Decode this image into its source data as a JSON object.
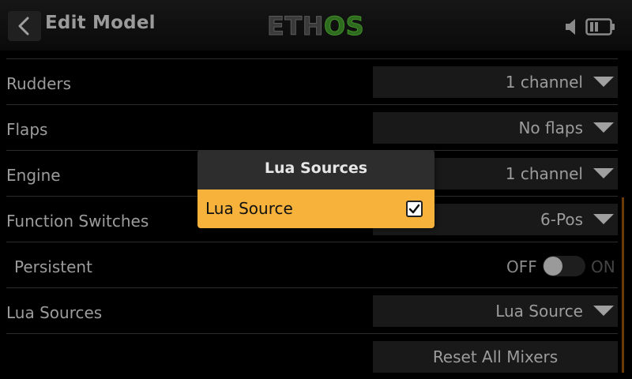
{
  "header": {
    "title": "Edit Model",
    "logo_part1": "ETH",
    "logo_part2": "OS",
    "back_icon": "chevron-left-icon",
    "speaker_icon": "speaker-muted-icon",
    "battery_icon": "battery-icon"
  },
  "rows": {
    "rudders": {
      "label": "Rudders",
      "value": "1 channel"
    },
    "flaps": {
      "label": "Flaps",
      "value": "No flaps"
    },
    "engine": {
      "label": "Engine",
      "value": "1 channel"
    },
    "function_switches": {
      "label": "Function Switches",
      "value": "6-Pos"
    },
    "persistent": {
      "label": "Persistent",
      "off_label": "OFF",
      "on_label": "ON",
      "state": "off"
    },
    "lua_sources": {
      "label": "Lua Sources",
      "value": "Lua Source"
    },
    "reset": {
      "button_label": "Reset All Mixers"
    }
  },
  "popup": {
    "title": "Lua Sources",
    "items": [
      {
        "label": "Lua Source",
        "checked": true
      }
    ]
  },
  "colors": {
    "accent": "#f7b23b",
    "logo_green": "#3f8f2a",
    "scrollbar": "#6a3b08"
  }
}
